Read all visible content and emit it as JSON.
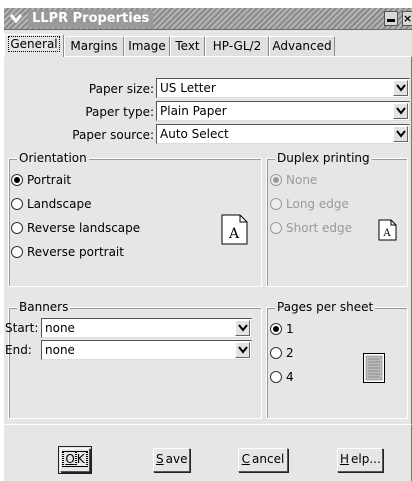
{
  "window": {
    "title": "LLPR Properties",
    "close_glyph": "×",
    "colors": {
      "titlebar": "#9a9a9a",
      "face": "#e6e6e6",
      "text_disabled": "#9a9a9a"
    }
  },
  "tabs": [
    {
      "label": "General",
      "active": true
    },
    {
      "label": "Margins",
      "active": false
    },
    {
      "label": "Image",
      "active": false
    },
    {
      "label": "Text",
      "active": false
    },
    {
      "label": "HP-GL/2",
      "active": false
    },
    {
      "label": "Advanced",
      "active": false
    }
  ],
  "general": {
    "paper_size": {
      "label": "Paper size:",
      "value": "US Letter"
    },
    "paper_type": {
      "label": "Paper type:",
      "value": "Plain Paper"
    },
    "paper_source": {
      "label": "Paper source:",
      "value": "Auto Select"
    }
  },
  "orientation": {
    "legend": "Orientation",
    "options": [
      "Portrait",
      "Landscape",
      "Reverse landscape",
      "Reverse portrait"
    ],
    "selected": "Portrait",
    "preview_letter": "A"
  },
  "duplex": {
    "legend": "Duplex printing",
    "options": [
      "None",
      "Long edge",
      "Short edge"
    ],
    "selected": "None",
    "preview_letter": "A"
  },
  "banners": {
    "legend": "Banners",
    "start_label": "Start:",
    "start_value": "none",
    "end_label": "End:",
    "end_value": "none"
  },
  "pages_per_sheet": {
    "legend": "Pages per sheet",
    "options": [
      "1",
      "2",
      "4"
    ],
    "selected": "1"
  },
  "buttons": {
    "ok": {
      "mnemonic": "O",
      "rest": "K"
    },
    "save": {
      "mnemonic": "S",
      "rest": "ave"
    },
    "cancel": {
      "mnemonic": "C",
      "rest": "ancel"
    },
    "help": {
      "mnemonic": "H",
      "rest": "elp..."
    }
  }
}
